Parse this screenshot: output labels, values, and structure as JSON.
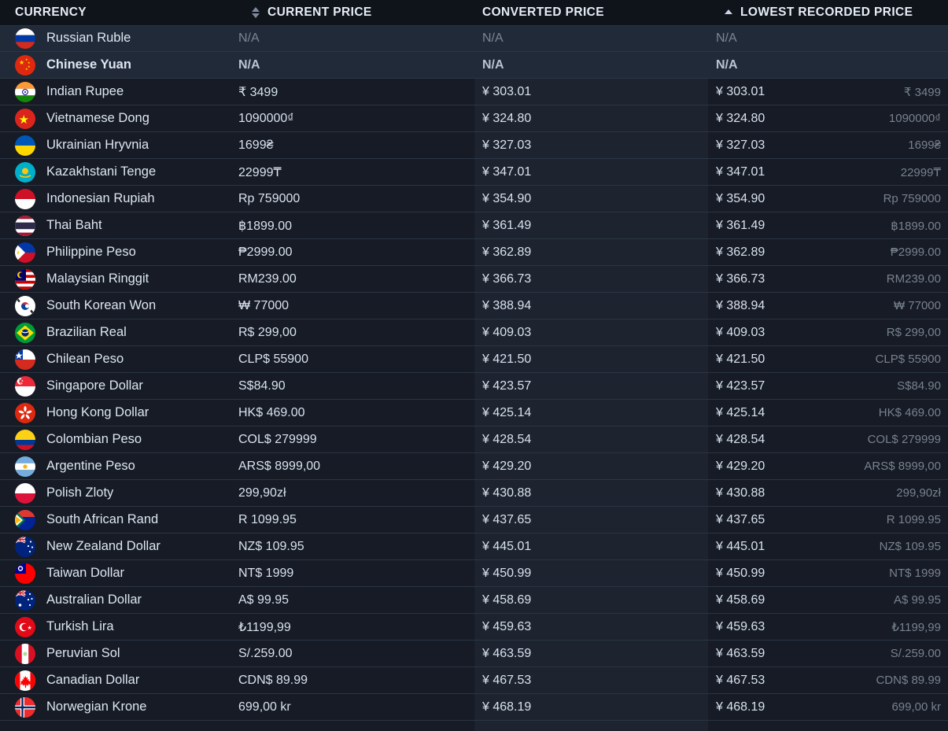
{
  "header": {
    "columns": [
      {
        "label": "CURRENCY",
        "sort": "none",
        "sort_icon": null
      },
      {
        "label": "CURRENT PRICE",
        "sort": "unsorted",
        "sort_icon": "sort-both-icon"
      },
      {
        "label": "CONVERTED PRICE",
        "sort": "none",
        "sort_icon": null
      },
      {
        "label": "LOWEST RECORDED PRICE",
        "sort": "ascending",
        "sort_icon": "sort-asc-icon"
      }
    ]
  },
  "colors": {
    "page_background": "#11151c",
    "header_background": "#0f131a",
    "column_band_dark": "#161b25",
    "column_band_light": "#1d2430",
    "row_highlight": "#212a38",
    "row_divider": "#2b3544",
    "text_primary": "#d8e2ee",
    "text_muted": "#78828f"
  },
  "rows": [
    {
      "flag": "flag-russia",
      "currency": "Russian Ruble",
      "current": "N/A",
      "converted": "N/A",
      "lowest": "N/A",
      "lowest_alt": "",
      "na": true,
      "bold": false,
      "highlight": true
    },
    {
      "flag": "flag-china",
      "currency": "Chinese Yuan",
      "current": "N/A",
      "converted": "N/A",
      "lowest": "N/A",
      "lowest_alt": "",
      "na": true,
      "bold": true,
      "highlight": true
    },
    {
      "flag": "flag-india",
      "currency": "Indian Rupee",
      "current": "₹ 3499",
      "converted": "¥ 303.01",
      "lowest": "¥ 303.01",
      "lowest_alt": "₹ 3499",
      "na": false,
      "bold": false,
      "highlight": false
    },
    {
      "flag": "flag-vietnam",
      "currency": "Vietnamese Dong",
      "current": "1090000₫",
      "converted": "¥ 324.80",
      "lowest": "¥ 324.80",
      "lowest_alt": "1090000₫",
      "na": false,
      "bold": false,
      "highlight": false
    },
    {
      "flag": "flag-ukraine",
      "currency": "Ukrainian Hryvnia",
      "current": "1699₴",
      "converted": "¥ 327.03",
      "lowest": "¥ 327.03",
      "lowest_alt": "1699₴",
      "na": false,
      "bold": false,
      "highlight": false
    },
    {
      "flag": "flag-kazakhstan",
      "currency": "Kazakhstani Tenge",
      "current": "22999₸",
      "converted": "¥ 347.01",
      "lowest": "¥ 347.01",
      "lowest_alt": "22999₸",
      "na": false,
      "bold": false,
      "highlight": false
    },
    {
      "flag": "flag-indonesia",
      "currency": "Indonesian Rupiah",
      "current": "Rp 759000",
      "converted": "¥ 354.90",
      "lowest": "¥ 354.90",
      "lowest_alt": "Rp 759000",
      "na": false,
      "bold": false,
      "highlight": false
    },
    {
      "flag": "flag-thailand",
      "currency": "Thai Baht",
      "current": "฿1899.00",
      "converted": "¥ 361.49",
      "lowest": "¥ 361.49",
      "lowest_alt": "฿1899.00",
      "na": false,
      "bold": false,
      "highlight": false
    },
    {
      "flag": "flag-philippines",
      "currency": "Philippine Peso",
      "current": "₱2999.00",
      "converted": "¥ 362.89",
      "lowest": "¥ 362.89",
      "lowest_alt": "₱2999.00",
      "na": false,
      "bold": false,
      "highlight": false
    },
    {
      "flag": "flag-malaysia",
      "currency": "Malaysian Ringgit",
      "current": "RM239.00",
      "converted": "¥ 366.73",
      "lowest": "¥ 366.73",
      "lowest_alt": "RM239.00",
      "na": false,
      "bold": false,
      "highlight": false
    },
    {
      "flag": "flag-south-korea",
      "currency": "South Korean Won",
      "current": "₩ 77000",
      "converted": "¥ 388.94",
      "lowest": "¥ 388.94",
      "lowest_alt": "₩ 77000",
      "na": false,
      "bold": false,
      "highlight": false
    },
    {
      "flag": "flag-brazil",
      "currency": "Brazilian Real",
      "current": "R$ 299,00",
      "converted": "¥ 409.03",
      "lowest": "¥ 409.03",
      "lowest_alt": "R$ 299,00",
      "na": false,
      "bold": false,
      "highlight": false
    },
    {
      "flag": "flag-chile",
      "currency": "Chilean Peso",
      "current": "CLP$ 55900",
      "converted": "¥ 421.50",
      "lowest": "¥ 421.50",
      "lowest_alt": "CLP$ 55900",
      "na": false,
      "bold": false,
      "highlight": false
    },
    {
      "flag": "flag-singapore",
      "currency": "Singapore Dollar",
      "current": "S$84.90",
      "converted": "¥ 423.57",
      "lowest": "¥ 423.57",
      "lowest_alt": "S$84.90",
      "na": false,
      "bold": false,
      "highlight": false
    },
    {
      "flag": "flag-hong-kong",
      "currency": "Hong Kong Dollar",
      "current": "HK$ 469.00",
      "converted": "¥ 425.14",
      "lowest": "¥ 425.14",
      "lowest_alt": "HK$ 469.00",
      "na": false,
      "bold": false,
      "highlight": false
    },
    {
      "flag": "flag-colombia",
      "currency": "Colombian Peso",
      "current": "COL$ 279999",
      "converted": "¥ 428.54",
      "lowest": "¥ 428.54",
      "lowest_alt": "COL$ 279999",
      "na": false,
      "bold": false,
      "highlight": false
    },
    {
      "flag": "flag-argentina",
      "currency": "Argentine Peso",
      "current": "ARS$ 8999,00",
      "converted": "¥ 429.20",
      "lowest": "¥ 429.20",
      "lowest_alt": "ARS$ 8999,00",
      "na": false,
      "bold": false,
      "highlight": false
    },
    {
      "flag": "flag-poland",
      "currency": "Polish Zloty",
      "current": "299,90zł",
      "converted": "¥ 430.88",
      "lowest": "¥ 430.88",
      "lowest_alt": "299,90zł",
      "na": false,
      "bold": false,
      "highlight": false
    },
    {
      "flag": "flag-south-africa",
      "currency": "South African Rand",
      "current": "R 1099.95",
      "converted": "¥ 437.65",
      "lowest": "¥ 437.65",
      "lowest_alt": "R 1099.95",
      "na": false,
      "bold": false,
      "highlight": false
    },
    {
      "flag": "flag-new-zealand",
      "currency": "New Zealand Dollar",
      "current": "NZ$ 109.95",
      "converted": "¥ 445.01",
      "lowest": "¥ 445.01",
      "lowest_alt": "NZ$ 109.95",
      "na": false,
      "bold": false,
      "highlight": false
    },
    {
      "flag": "flag-taiwan",
      "currency": "Taiwan Dollar",
      "current": "NT$ 1999",
      "converted": "¥ 450.99",
      "lowest": "¥ 450.99",
      "lowest_alt": "NT$ 1999",
      "na": false,
      "bold": false,
      "highlight": false
    },
    {
      "flag": "flag-australia",
      "currency": "Australian Dollar",
      "current": "A$ 99.95",
      "converted": "¥ 458.69",
      "lowest": "¥ 458.69",
      "lowest_alt": "A$ 99.95",
      "na": false,
      "bold": false,
      "highlight": false
    },
    {
      "flag": "flag-turkey",
      "currency": "Turkish Lira",
      "current": "₺1199,99",
      "converted": "¥ 459.63",
      "lowest": "¥ 459.63",
      "lowest_alt": "₺1199,99",
      "na": false,
      "bold": false,
      "highlight": false
    },
    {
      "flag": "flag-peru",
      "currency": "Peruvian Sol",
      "current": "S/.259.00",
      "converted": "¥ 463.59",
      "lowest": "¥ 463.59",
      "lowest_alt": "S/.259.00",
      "na": false,
      "bold": false,
      "highlight": false
    },
    {
      "flag": "flag-canada",
      "currency": "Canadian Dollar",
      "current": "CDN$ 89.99",
      "converted": "¥ 467.53",
      "lowest": "¥ 467.53",
      "lowest_alt": "CDN$ 89.99",
      "na": false,
      "bold": false,
      "highlight": false
    },
    {
      "flag": "flag-norway",
      "currency": "Norwegian Krone",
      "current": "699,00 kr",
      "converted": "¥ 468.19",
      "lowest": "¥ 468.19",
      "lowest_alt": "699,00 kr",
      "na": false,
      "bold": false,
      "highlight": false
    }
  ]
}
